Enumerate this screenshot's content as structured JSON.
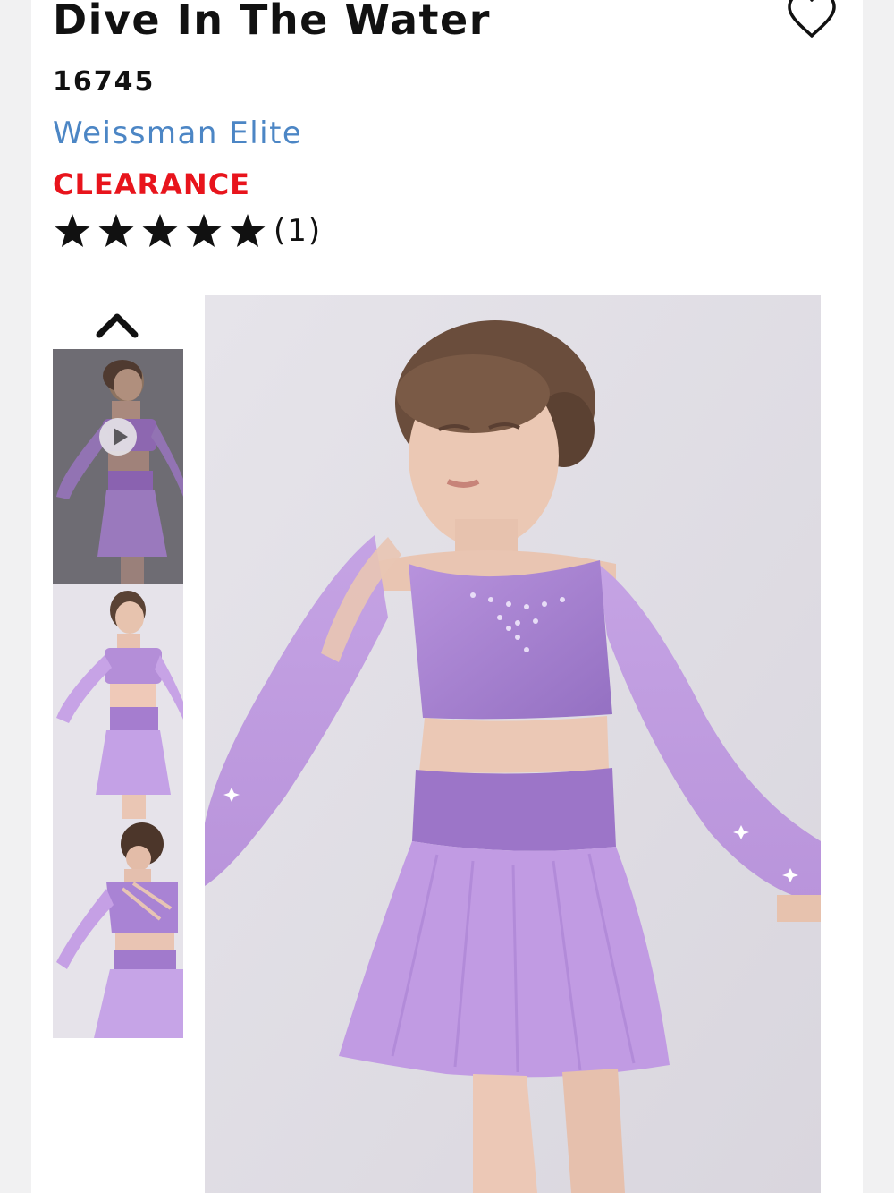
{
  "product": {
    "title": "Dive In The Water",
    "sku": "16745",
    "brand": "Weissman Elite",
    "badge": "CLEARANCE",
    "rating": {
      "stars": 5,
      "max_stars": 5,
      "count_label": "(1)"
    }
  },
  "icons": {
    "wishlist": "heart-outline-icon",
    "gallery_up": "chevron-up-icon",
    "video": "play-icon",
    "rating": "star-icon"
  },
  "gallery": {
    "thumbnails": [
      {
        "view": "front",
        "has_video": true
      },
      {
        "view": "front",
        "has_video": false
      },
      {
        "view": "back",
        "has_video": false
      }
    ]
  },
  "colors": {
    "brand_link": "#4c86c5",
    "clearance": "#e8141c",
    "text": "#111111",
    "costume": "#a77fcf"
  }
}
